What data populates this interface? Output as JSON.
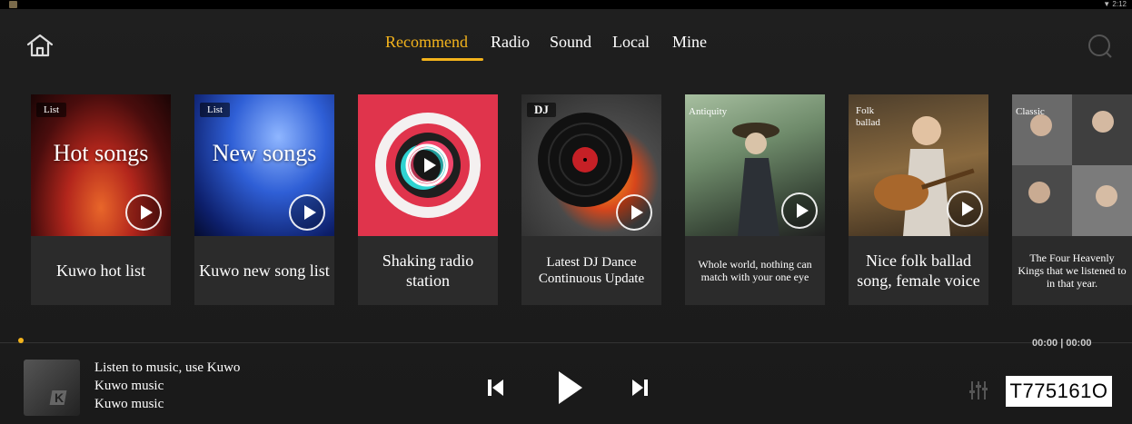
{
  "status": {
    "time": "2:12",
    "wifi_icon": "wifi-icon"
  },
  "header": {
    "tabs": [
      "Recommend",
      "Radio",
      "Sound",
      "Local",
      "Mine"
    ],
    "active_tab": "Recommend",
    "accent_color": "#f3b31c"
  },
  "cards": [
    {
      "tag": "List",
      "overlay": "Hot songs",
      "caption": "Kuwo hot list"
    },
    {
      "tag": "List",
      "overlay": "New songs",
      "caption": "Kuwo new song list"
    },
    {
      "tag": "",
      "overlay": "",
      "caption": "Shaking radio station"
    },
    {
      "tag": "DJ",
      "overlay": "",
      "caption": "Latest DJ Dance Continuous Update"
    },
    {
      "tag": "Antiquity",
      "overlay": "",
      "caption": "Whole world, nothing can match with your one eye"
    },
    {
      "tag": "Folk ballad",
      "overlay": "",
      "caption": "Nice folk ballad song, female voice"
    },
    {
      "tag": "Classic",
      "overlay": "",
      "caption": "The Four Heavenly Kings that we listened to in that year."
    }
  ],
  "player": {
    "title": "Listen to music, use Kuwo",
    "artist": "Kuwo music",
    "album": "Kuwo music",
    "time": "00:00 | 00:00",
    "progress_percent": 0
  },
  "watermark_code": "T775161O"
}
